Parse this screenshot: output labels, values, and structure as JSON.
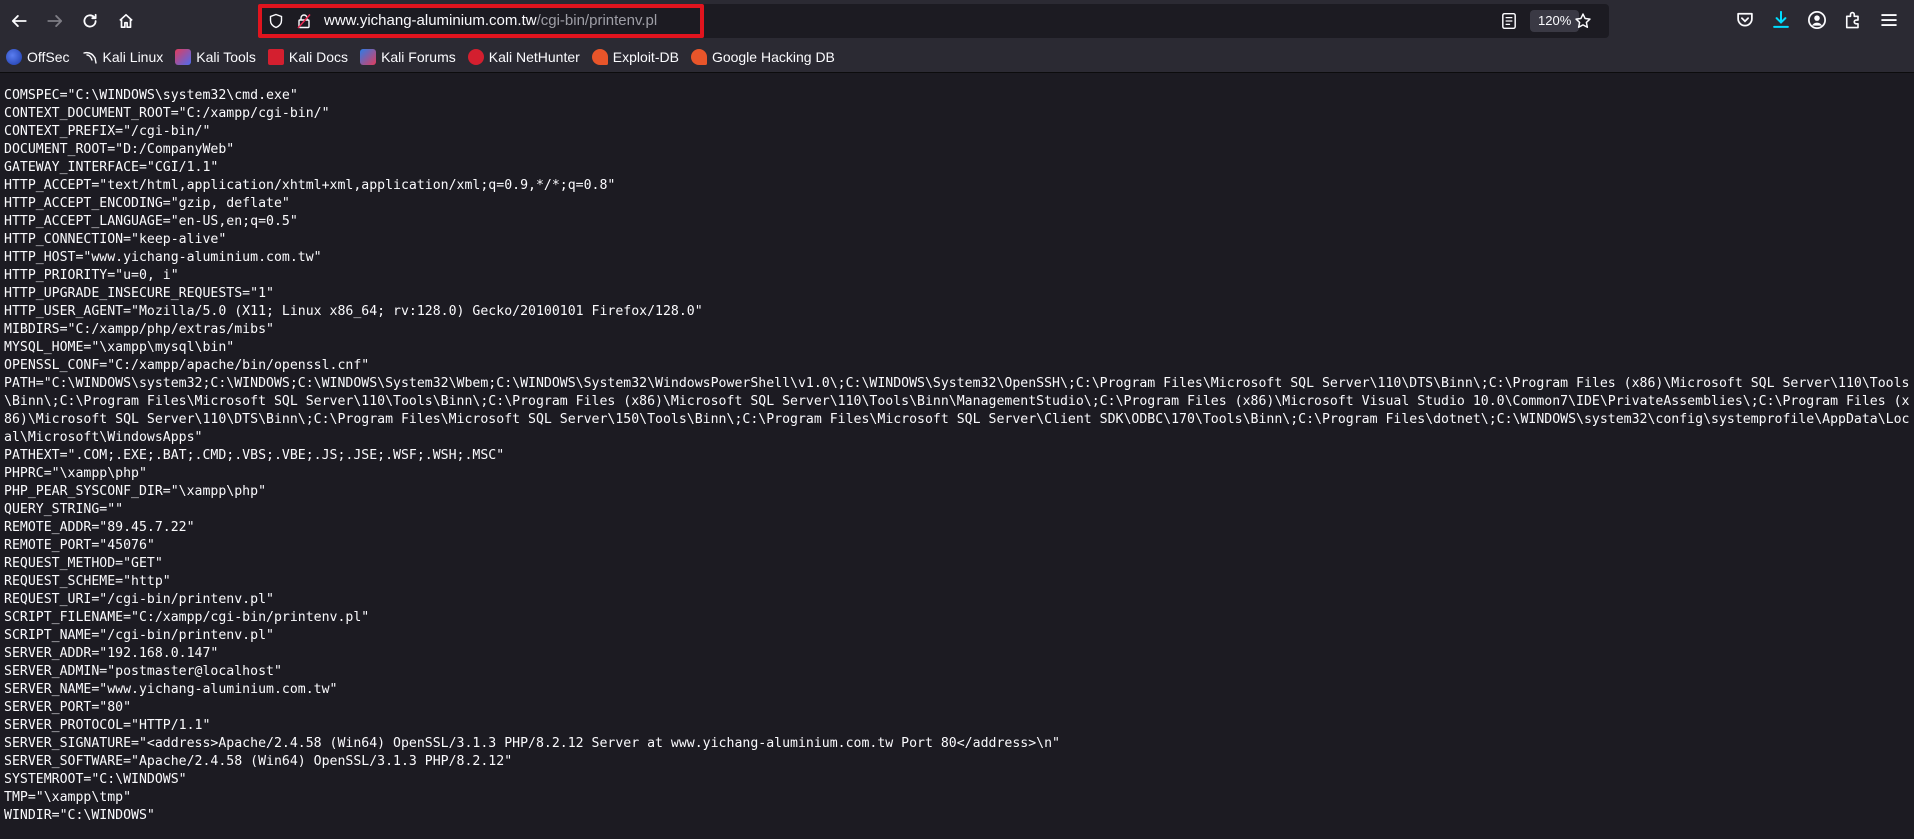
{
  "browser": {
    "url_host": "www.yichang-aluminium.com.tw",
    "url_path": "/cgi-bin/printenv.pl",
    "zoom": "120%",
    "colors": {
      "highlight": "#e0141e",
      "download_icon": "#0df"
    }
  },
  "bookmarks": [
    {
      "label": "OffSec",
      "icon": "offsec-icon"
    },
    {
      "label": "Kali Linux",
      "icon": "kali-dragon-icon"
    },
    {
      "label": "Kali Tools",
      "icon": "kali-tools-icon"
    },
    {
      "label": "Kali Docs",
      "icon": "kali-docs-icon"
    },
    {
      "label": "Kali Forums",
      "icon": "kali-forums-icon"
    },
    {
      "label": "Kali NetHunter",
      "icon": "nethunter-icon"
    },
    {
      "label": "Exploit-DB",
      "icon": "exploit-db-icon"
    },
    {
      "label": "Google Hacking DB",
      "icon": "ghdb-icon"
    }
  ],
  "env": [
    "COMSPEC=\"C:\\WINDOWS\\system32\\cmd.exe\"",
    "CONTEXT_DOCUMENT_ROOT=\"C:/xampp/cgi-bin/\"",
    "CONTEXT_PREFIX=\"/cgi-bin/\"",
    "DOCUMENT_ROOT=\"D:/CompanyWeb\"",
    "GATEWAY_INTERFACE=\"CGI/1.1\"",
    "HTTP_ACCEPT=\"text/html,application/xhtml+xml,application/xml;q=0.9,*/*;q=0.8\"",
    "HTTP_ACCEPT_ENCODING=\"gzip, deflate\"",
    "HTTP_ACCEPT_LANGUAGE=\"en-US,en;q=0.5\"",
    "HTTP_CONNECTION=\"keep-alive\"",
    "HTTP_HOST=\"www.yichang-aluminium.com.tw\"",
    "HTTP_PRIORITY=\"u=0, i\"",
    "HTTP_UPGRADE_INSECURE_REQUESTS=\"1\"",
    "HTTP_USER_AGENT=\"Mozilla/5.0 (X11; Linux x86_64; rv:128.0) Gecko/20100101 Firefox/128.0\"",
    "MIBDIRS=\"C:/xampp/php/extras/mibs\"",
    "MYSQL_HOME=\"\\xampp\\mysql\\bin\"",
    "OPENSSL_CONF=\"C:/xampp/apache/bin/openssl.cnf\"",
    "PATH=\"C:\\WINDOWS\\system32;C:\\WINDOWS;C:\\WINDOWS\\System32\\Wbem;C:\\WINDOWS\\System32\\WindowsPowerShell\\v1.0\\;C:\\WINDOWS\\System32\\OpenSSH\\;C:\\Program Files\\Microsoft SQL Server\\110\\DTS\\Binn\\;C:\\Program Files (x86)\\Microsoft SQL Server\\110\\Tools\\Binn\\;C:\\Program Files\\Microsoft SQL Server\\110\\Tools\\Binn\\;C:\\Program Files (x86)\\Microsoft SQL Server\\110\\Tools\\Binn\\ManagementStudio\\;C:\\Program Files (x86)\\Microsoft Visual Studio 10.0\\Common7\\IDE\\PrivateAssemblies\\;C:\\Program Files (x86)\\Microsoft SQL Server\\110\\DTS\\Binn\\;C:\\Program Files\\Microsoft SQL Server\\150\\Tools\\Binn\\;C:\\Program Files\\Microsoft SQL Server\\Client SDK\\ODBC\\170\\Tools\\Binn\\;C:\\Program Files\\dotnet\\;C:\\WINDOWS\\system32\\config\\systemprofile\\AppData\\Local\\Microsoft\\WindowsApps\"",
    "PATHEXT=\".COM;.EXE;.BAT;.CMD;.VBS;.VBE;.JS;.JSE;.WSF;.WSH;.MSC\"",
    "PHPRC=\"\\xampp\\php\"",
    "PHP_PEAR_SYSCONF_DIR=\"\\xampp\\php\"",
    "QUERY_STRING=\"\"",
    "REMOTE_ADDR=\"89.45.7.22\"",
    "REMOTE_PORT=\"45076\"",
    "REQUEST_METHOD=\"GET\"",
    "REQUEST_SCHEME=\"http\"",
    "REQUEST_URI=\"/cgi-bin/printenv.pl\"",
    "SCRIPT_FILENAME=\"C:/xampp/cgi-bin/printenv.pl\"",
    "SCRIPT_NAME=\"/cgi-bin/printenv.pl\"",
    "SERVER_ADDR=\"192.168.0.147\"",
    "SERVER_ADMIN=\"postmaster@localhost\"",
    "SERVER_NAME=\"www.yichang-aluminium.com.tw\"",
    "SERVER_PORT=\"80\"",
    "SERVER_PROTOCOL=\"HTTP/1.1\"",
    "SERVER_SIGNATURE=\"<address>Apache/2.4.58 (Win64) OpenSSL/3.1.3 PHP/8.2.12 Server at www.yichang-aluminium.com.tw Port 80</address>\\n\"",
    "SERVER_SOFTWARE=\"Apache/2.4.58 (Win64) OpenSSL/3.1.3 PHP/8.2.12\"",
    "SYSTEMROOT=\"C:\\WINDOWS\"",
    "TMP=\"\\xampp\\tmp\"",
    "WINDIR=\"C:\\WINDOWS\""
  ]
}
